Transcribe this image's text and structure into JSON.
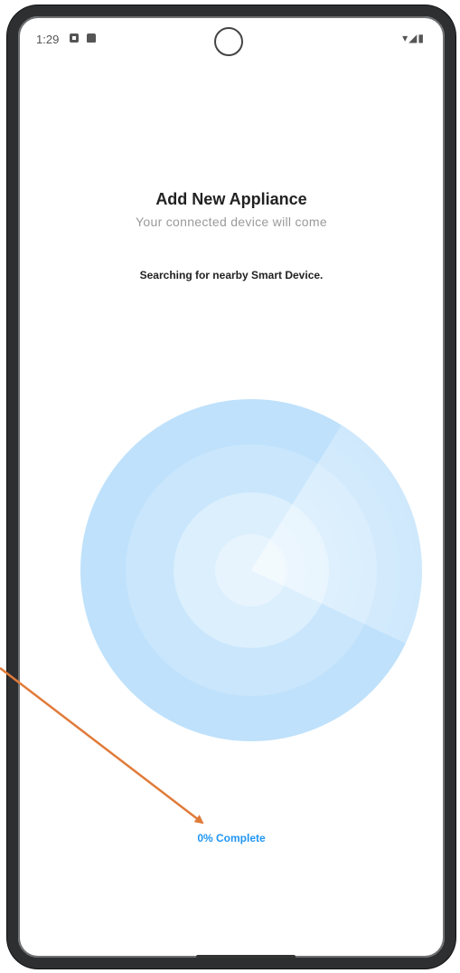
{
  "status_bar": {
    "time": "1:29",
    "icons_right": "▾◢▮"
  },
  "screen": {
    "title": "Add New Appliance",
    "subtitle": "Your connected device will come",
    "searching_text": "Searching for nearby Smart Device.",
    "progress": {
      "percent": 0,
      "label": "0% Complete"
    }
  },
  "colors": {
    "accent": "#2196f3",
    "radar_outer": "#bfe1fb",
    "radar_mid": "#cfe8fc",
    "radar_inner": "#e6f4fe",
    "frame": "#2d2f31",
    "annotation_arrow": "#e07b39"
  }
}
